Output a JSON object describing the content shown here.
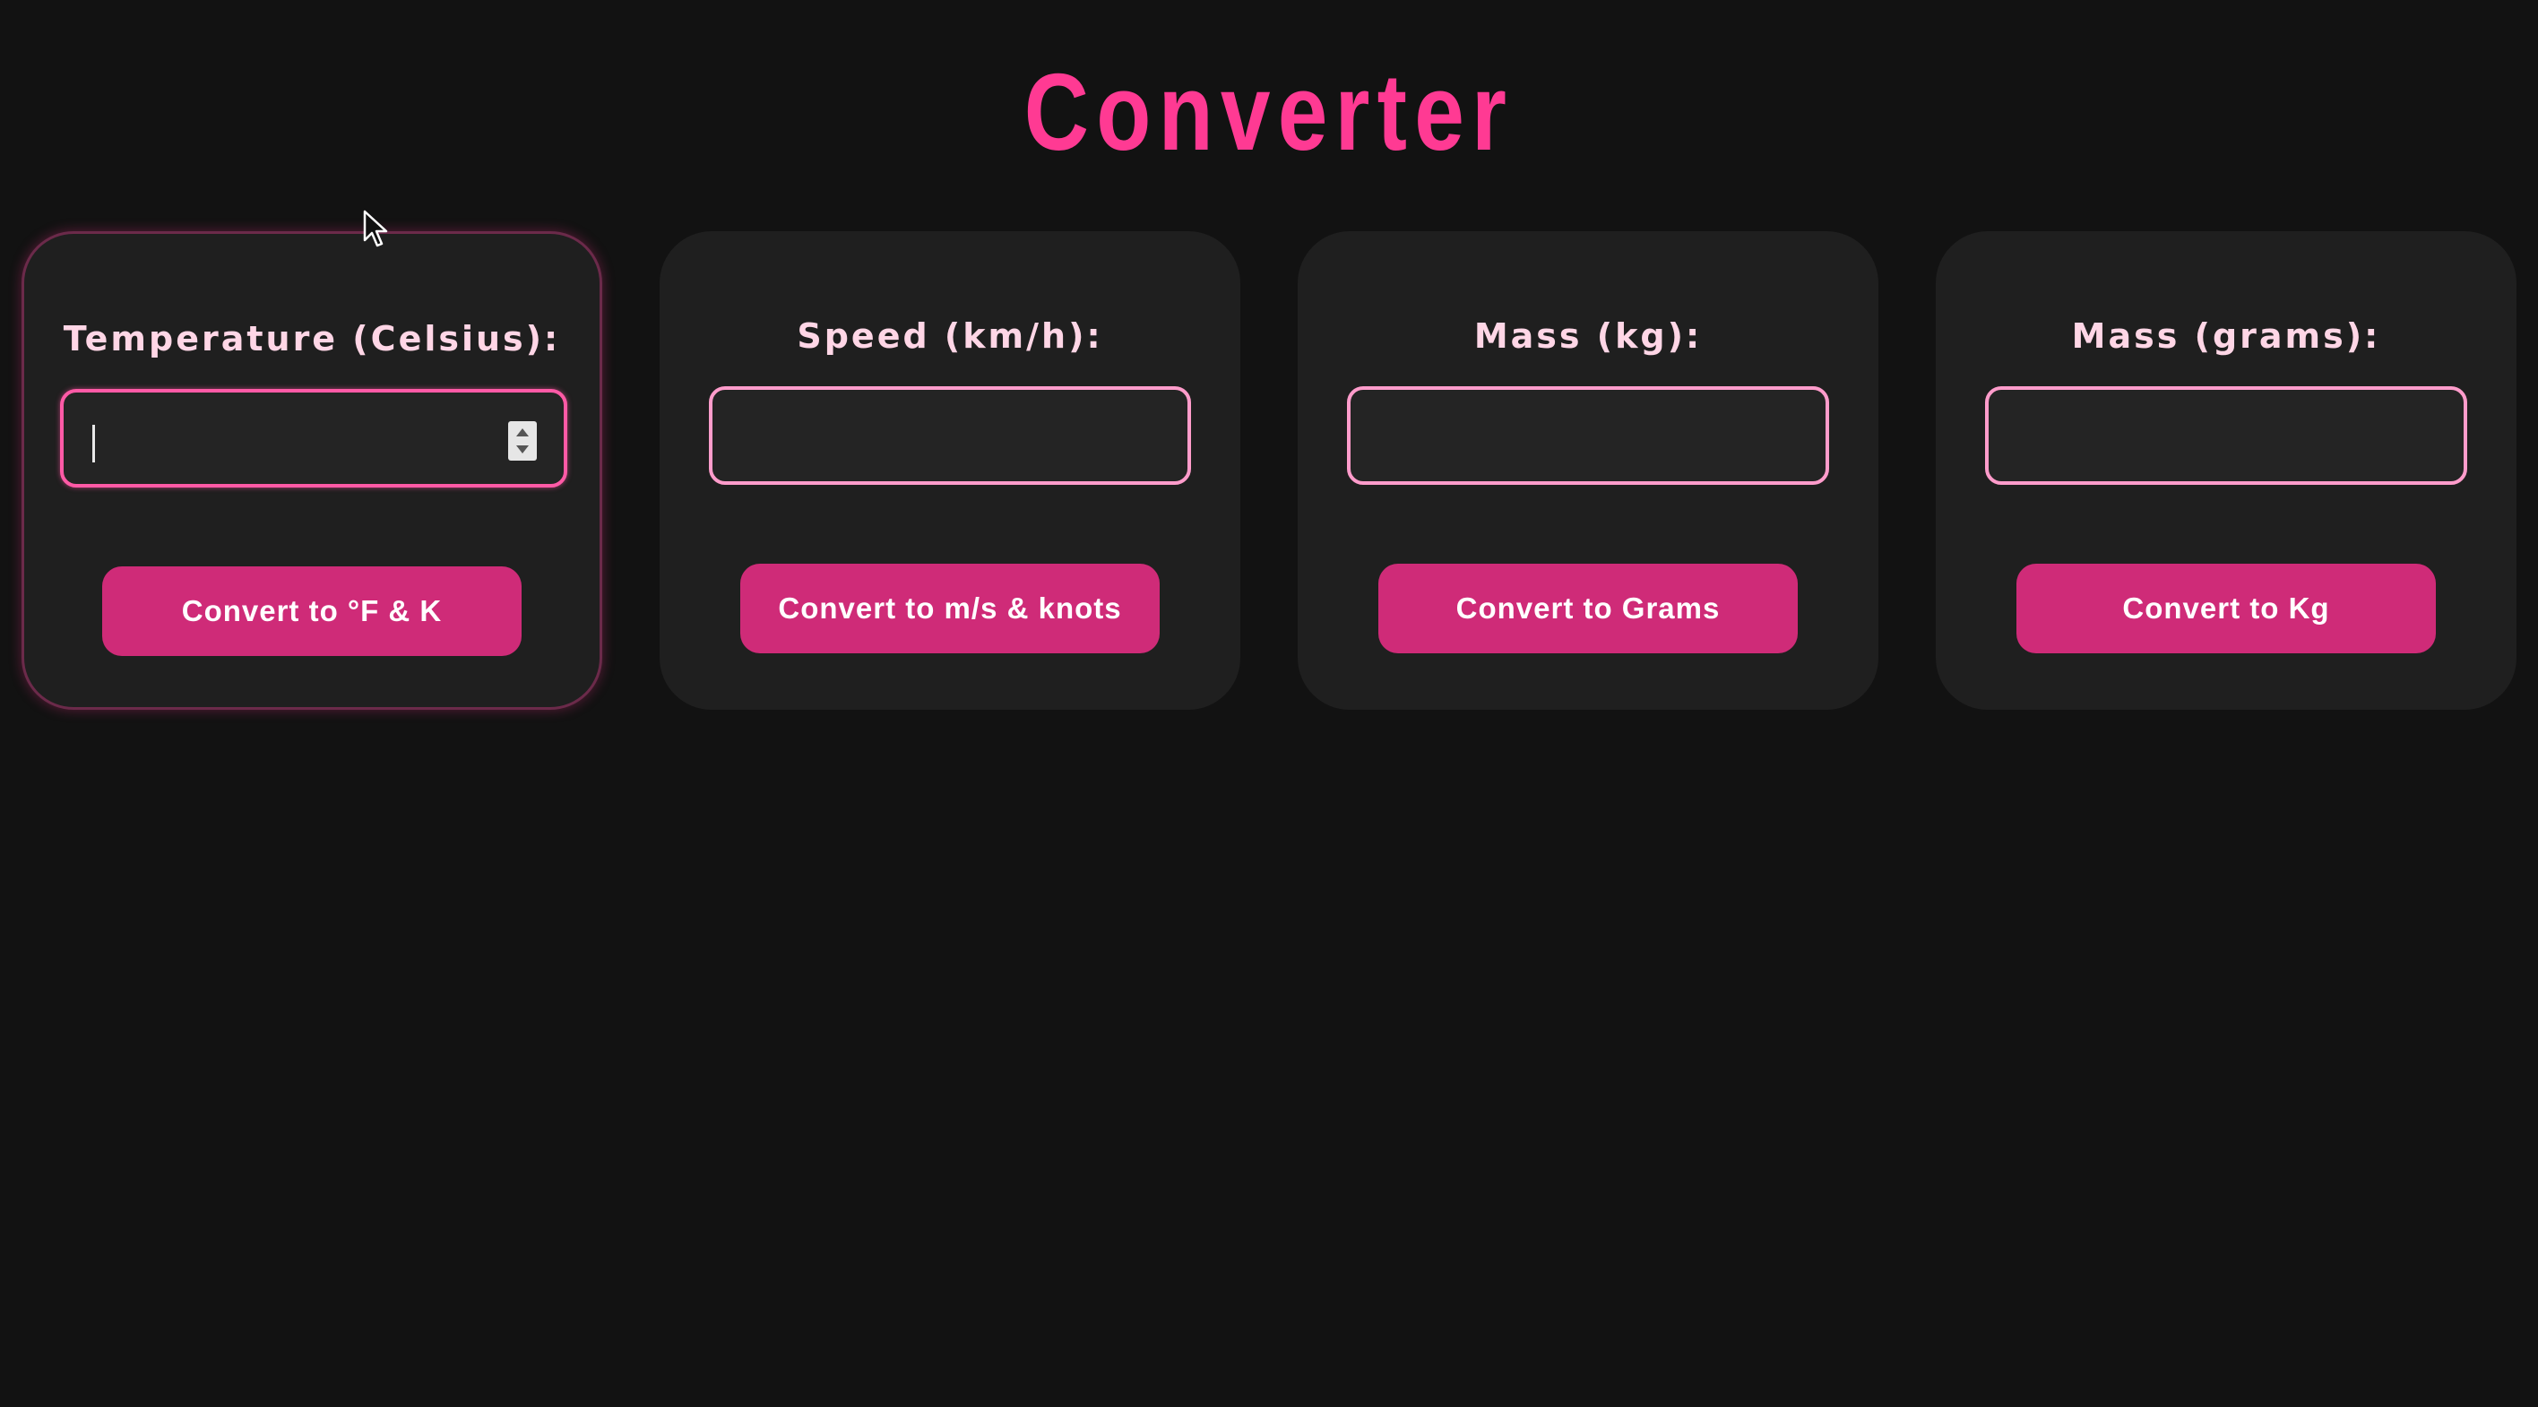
{
  "page": {
    "title": "Converter"
  },
  "cards": [
    {
      "label": "Temperature (Celsius):",
      "input_value": "",
      "button_label": "Convert to °F & K"
    },
    {
      "label": "Speed (km/h):",
      "input_value": "",
      "button_label": "Convert to m/s & knots"
    },
    {
      "label": "Mass (kg):",
      "input_value": "",
      "button_label": "Convert to Grams"
    },
    {
      "label": "Mass (grams):",
      "input_value": "",
      "button_label": "Convert to Kg"
    }
  ],
  "colors": {
    "background": "#121212",
    "card": "#1f1f1f",
    "accent": "#ff3a93",
    "button": "#cf2b78",
    "field_border": "#ff9ccb",
    "label": "#ffd6e6"
  },
  "icons": {
    "spinner": "number-spinner-icon",
    "cursor": "mouse-pointer-icon"
  }
}
